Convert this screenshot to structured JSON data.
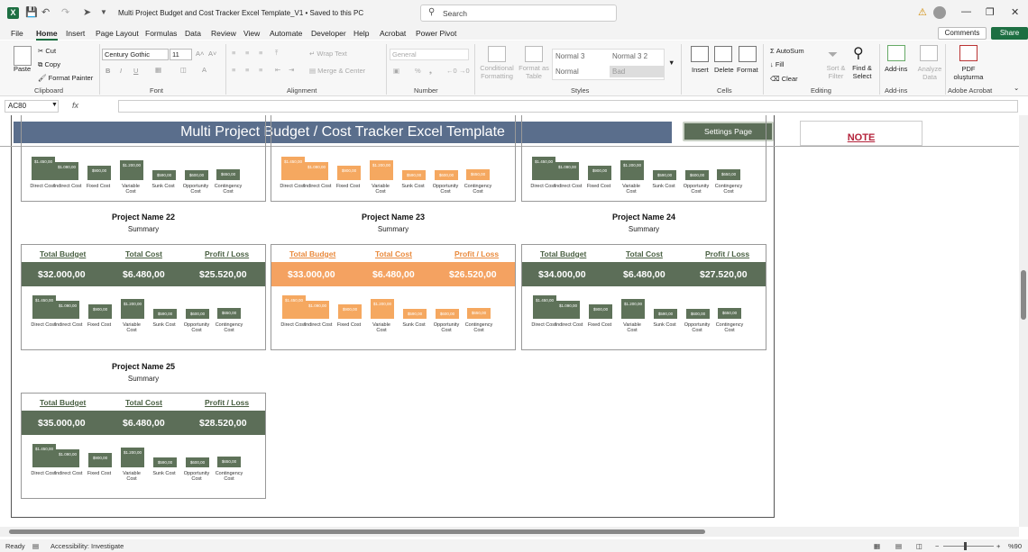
{
  "titlebar": {
    "doc_title": "Multi Project Budget and Cost Tracker Excel Template_V1  •  Saved to this PC",
    "search_placeholder": "Search"
  },
  "menu": [
    "File",
    "Home",
    "Insert",
    "Page Layout",
    "Formulas",
    "Data",
    "Review",
    "View",
    "Automate",
    "Developer",
    "Help",
    "Acrobat",
    "Power Pivot"
  ],
  "comments_label": "Comments",
  "share_label": "Share",
  "ribbon": {
    "clipboard": {
      "paste": "Paste",
      "cut": "Cut",
      "copy": "Copy",
      "format_painter": "Format Painter",
      "label": "Clipboard"
    },
    "font": {
      "name": "Century Gothic",
      "size": "11",
      "label": "Font"
    },
    "alignment": {
      "wrap": "Wrap Text",
      "merge": "Merge & Center",
      "label": "Alignment"
    },
    "number": {
      "format": "General",
      "label": "Number"
    },
    "styles": {
      "cond": "Conditional Formatting",
      "table": "Format as Table",
      "s1": "Normal 3",
      "s2": "Normal 3 2",
      "s3": "Normal",
      "s4": "Bad",
      "label": "Styles"
    },
    "cells": {
      "insert": "Insert",
      "delete": "Delete",
      "format": "Format",
      "label": "Cells"
    },
    "editing": {
      "autosum": "AutoSum",
      "fill": "Fill",
      "clear": "Clear",
      "sort": "Sort & Filter",
      "find": "Find & Select",
      "label": "Editing"
    },
    "addins": {
      "addins": "Add-ins",
      "analyze": "Analyze Data",
      "label": "Add-ins"
    },
    "acrobat": {
      "pdf": "PDF oluşturma",
      "label": "Adobe Acrobat"
    }
  },
  "namebox": "AC80",
  "sheet": {
    "banner": "Multi Project Budget / Cost Tracker Excel Template",
    "settings_button": "Settings Page",
    "note": "NOTE",
    "headers": {
      "budget": "Total Budget",
      "cost": "Total Cost",
      "profit": "Profit / Loss"
    },
    "summary": "Summary",
    "categories": [
      "Direct Cost",
      "Indirect Cost",
      "Fixed Cost",
      "Variable Cost",
      "Sunk Cost",
      "Opportunity Cost",
      "Contingency Cost"
    ],
    "bar_values": [
      1450,
      1090,
      900,
      1200,
      590,
      600,
      650
    ],
    "bar_labels": [
      "$1.450,00",
      "$1.090,00",
      "$900,00",
      "$1.200,00",
      "$590,00",
      "$600,00",
      "$650,00"
    ],
    "projects": [
      {
        "name": "Project Name 22",
        "budget": "$32.000,00",
        "cost": "$6.480,00",
        "profit": "$25.520,00",
        "theme": "green"
      },
      {
        "name": "Project Name 23",
        "budget": "$33.000,00",
        "cost": "$6.480,00",
        "profit": "$26.520,00",
        "theme": "orange"
      },
      {
        "name": "Project Name 24",
        "budget": "$34.000,00",
        "cost": "$6.480,00",
        "profit": "$27.520,00",
        "theme": "green"
      },
      {
        "name": "Project Name 25",
        "budget": "$35.000,00",
        "cost": "$6.480,00",
        "profit": "$28.520,00",
        "theme": "green"
      }
    ],
    "colors": {
      "green": "#5c6e58",
      "green_bar": "#5e7259",
      "orange": "#f4a261",
      "orange_bar": "#f5a860",
      "orange_hdr": "#e98a3d",
      "green_hdr": "#4a6043"
    }
  },
  "status": {
    "ready": "Ready",
    "accessibility": "Accessibility: Investigate",
    "zoom": "%90"
  }
}
